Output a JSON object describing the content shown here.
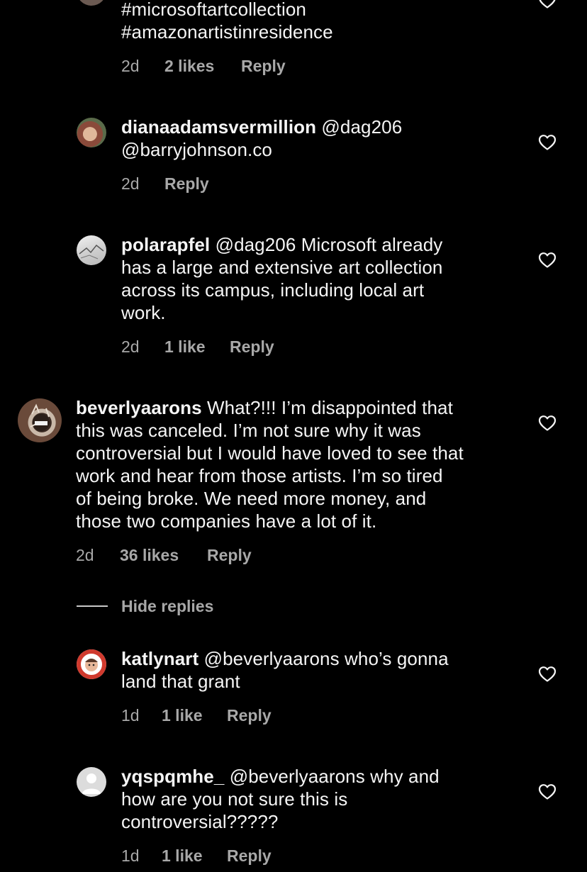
{
  "comments": [
    {
      "text_lines": [
        "#microsoftartcollection",
        "#amazonartistinresidence"
      ],
      "time": "2d",
      "likes": "2 likes",
      "reply": "Reply"
    },
    {
      "username": "dianaadamsvermillion",
      "text_lines": [
        " @dag206",
        "@barryjohnson.co"
      ],
      "time": "2d",
      "reply": "Reply"
    },
    {
      "username": "polarapfel",
      "text_lines": [
        " @dag206 Microsoft already",
        "has a large and extensive art collection",
        "across its campus, including local art",
        "work."
      ],
      "time": "2d",
      "likes": "1 like",
      "reply": "Reply"
    },
    {
      "username": "beverlyaarons",
      "text_lines": [
        " What?!!! I’m disappointed that",
        "this was canceled. I’m not sure why it was",
        "controversial but I would have loved to see that",
        "work and hear from those artists. I’m so tired",
        "of being broke. We need more money, and",
        "those two companies have a lot of it."
      ],
      "time": "2d",
      "likes": "36 likes",
      "reply": "Reply"
    },
    {
      "username": "katlynart",
      "text_lines": [
        " @beverlyaarons who’s gonna",
        "land that grant"
      ],
      "time": "1d",
      "likes": "1 like",
      "reply": "Reply"
    },
    {
      "username": "yqspqmhe_",
      "text_lines": [
        " @beverlyaarons why and",
        "how are you not sure this is",
        "controversial?????"
      ],
      "time": "1d",
      "likes": "1 like",
      "reply": "Reply"
    }
  ],
  "hide_replies": "Hide replies",
  "icons": {
    "like": "heart-outline-icon"
  },
  "colors": {
    "background": "#000000",
    "text": "#f5f5f5",
    "secondary": "#a8a8a8"
  }
}
